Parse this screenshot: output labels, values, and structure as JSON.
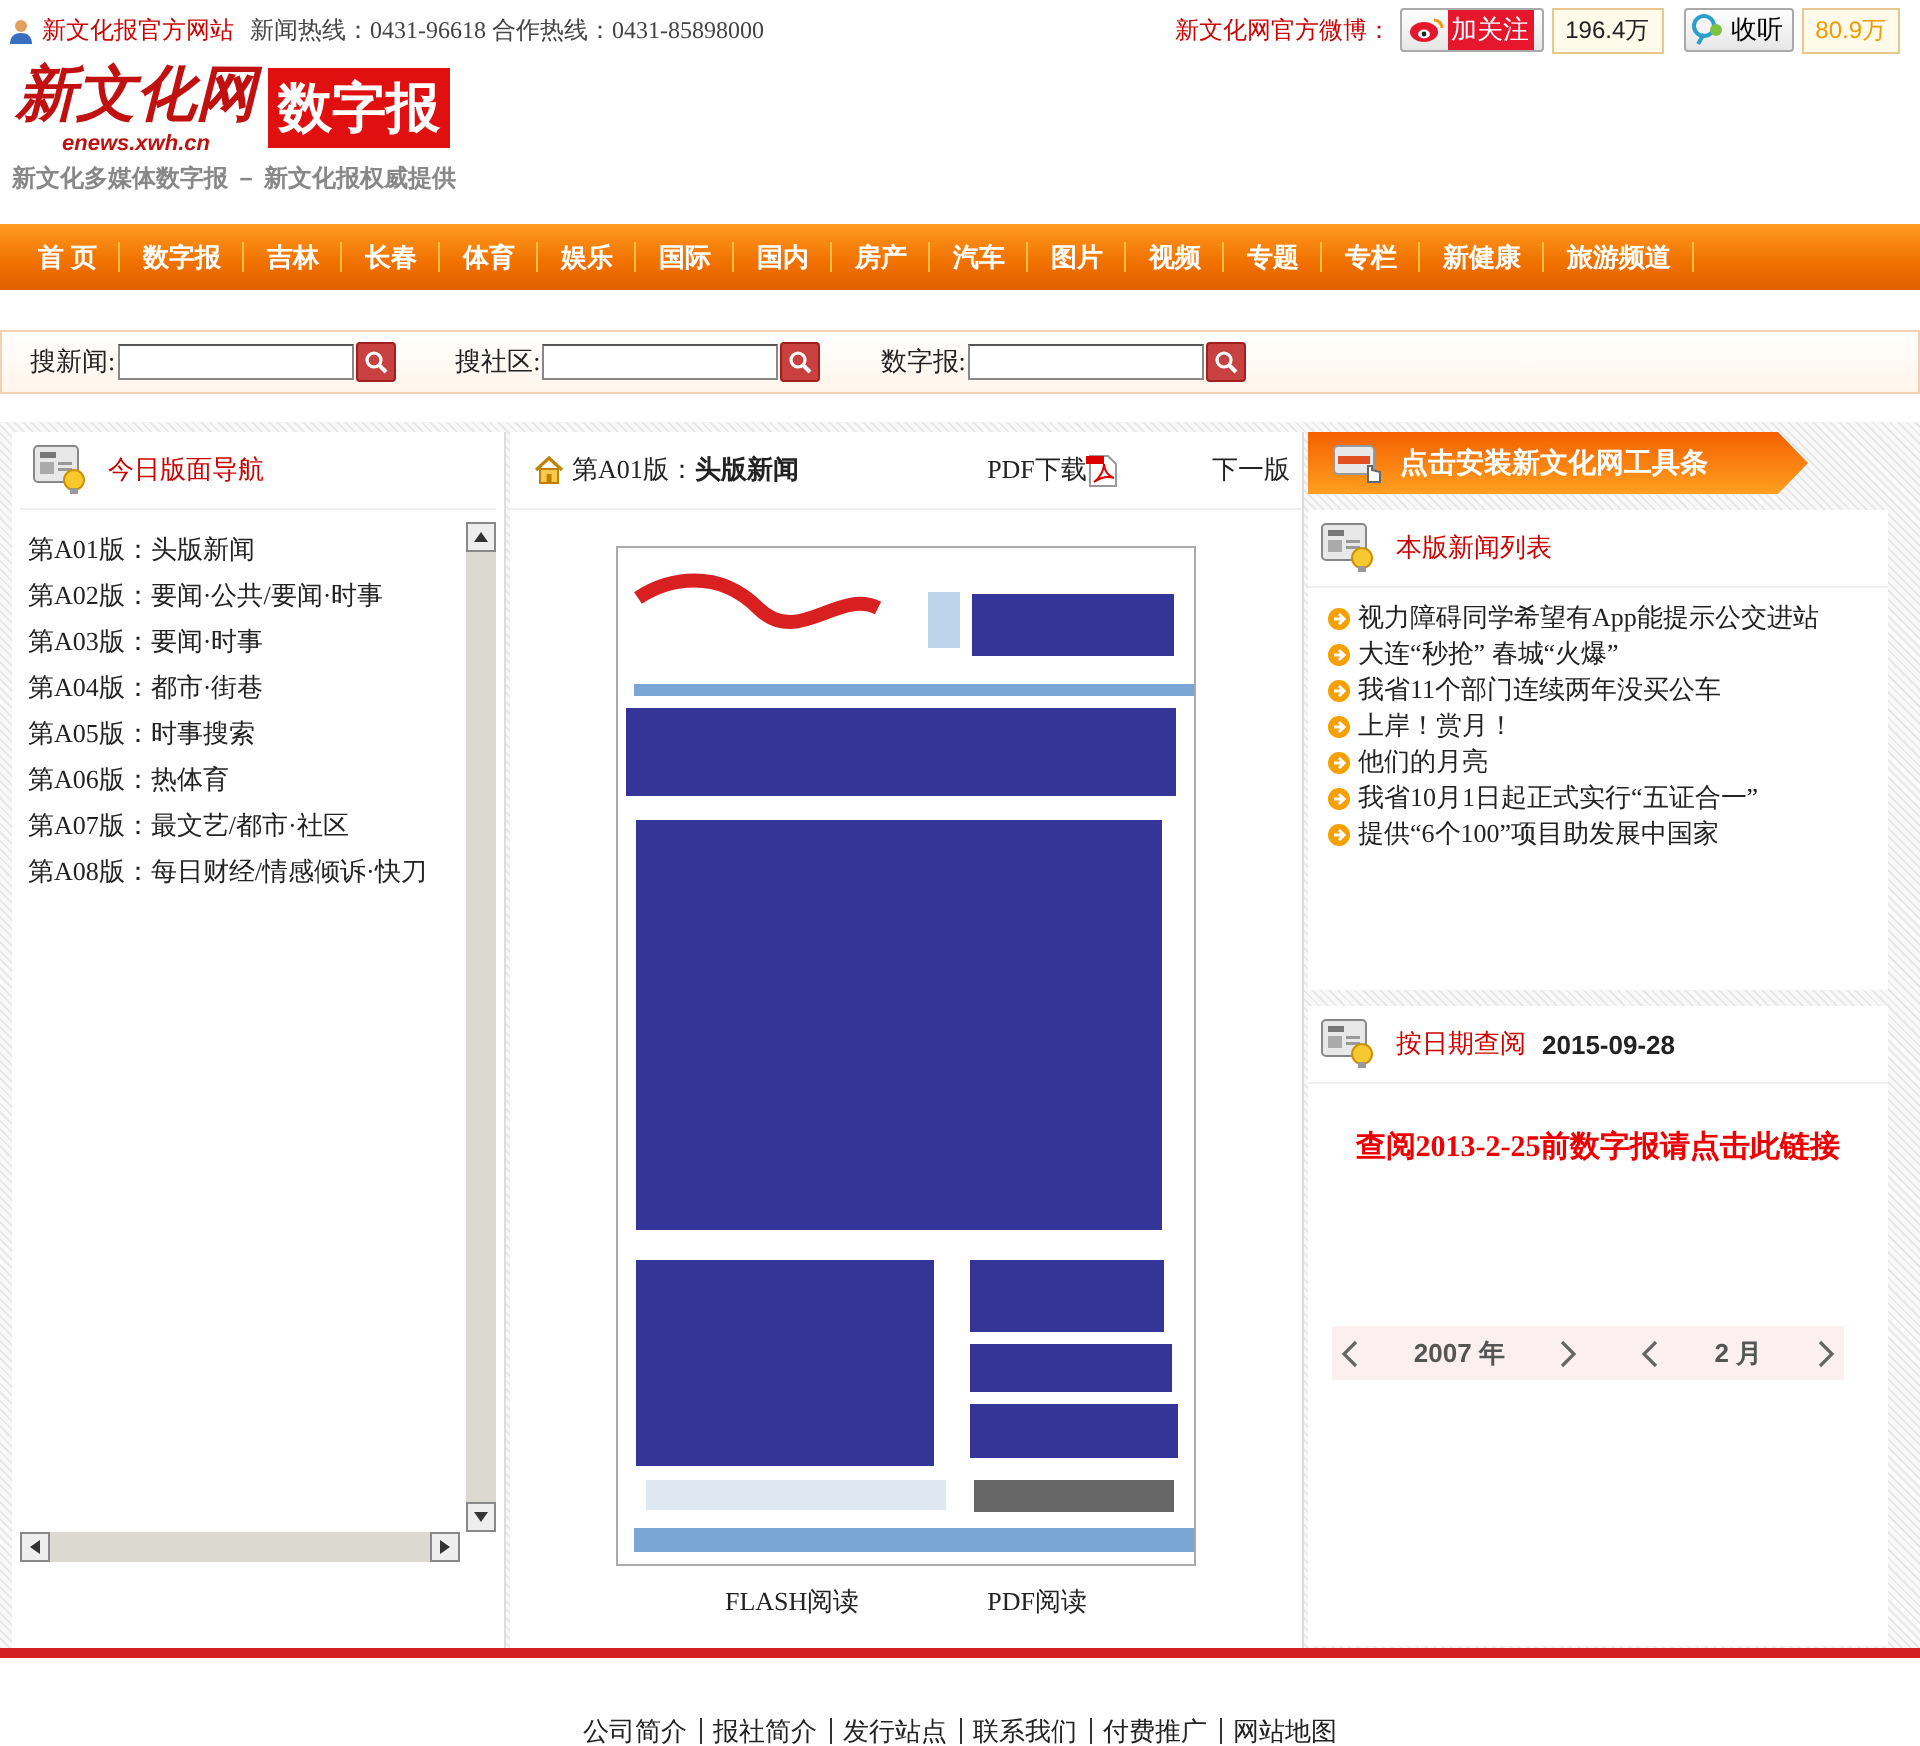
{
  "top_bar": {
    "site_link": "新文化报官方网站",
    "hotlines": "新闻热线：0431-96618 合作热线：0431-85898000",
    "weibo_label": "新文化网官方微博：",
    "follow": [
      {
        "kind": "weibo",
        "label": "加关注",
        "count": "196.4万"
      },
      {
        "kind": "tencent",
        "label": "收听",
        "count": "80.9万"
      }
    ]
  },
  "logo": {
    "title": "新文化网",
    "domain": "enews.xwh.cn",
    "badge": "数字报",
    "tagline": "新文化多媒体数字报 － 新文化报权威提供"
  },
  "nav": [
    "首 页",
    "数字报",
    "吉林",
    "长春",
    "体育",
    "娱乐",
    "国际",
    "国内",
    "房产",
    "汽车",
    "图片",
    "视频",
    "专题",
    "专栏",
    "新健康",
    "旅游频道"
  ],
  "search": [
    {
      "label": "搜新闻:"
    },
    {
      "label": "搜社区:"
    },
    {
      "label": "数字报:"
    }
  ],
  "left": {
    "title": "今日版面导航",
    "pages": [
      "第A01版：头版新闻",
      "第A02版：要闻·公共/要闻·时事",
      "第A03版：要闻·时事",
      "第A04版：都市·街巷",
      "第A05版：时事搜索",
      "第A06版：热体育",
      "第A07版：最文艺/都市·社区",
      "第A08版：每日财经/情感倾诉·快刀"
    ]
  },
  "center": {
    "page_label": "第A01版：",
    "page_name": "头版新闻",
    "pdf_download": "PDF下载",
    "next_page": "下一版",
    "read_links": [
      "FLASH阅读",
      "PDF阅读"
    ]
  },
  "right": {
    "toolbar_banner": "点击安装新文化网工具条",
    "news_title": "本版新闻列表",
    "news": [
      "视力障碍同学希望有App能提示公交进站",
      "大连“秒抢” 春城“火爆”",
      "我省11个部门连续两年没买公车",
      "上岸！赏月！",
      "他们的月亮",
      "我省10月1日起正式实行“五证合一”",
      "提供“6个100”项目助发展中国家"
    ],
    "date_title": "按日期查阅",
    "date": "2015-09-28",
    "archive_link": "查阅2013-2-25前数字报请点击此链接",
    "calendar": {
      "year": "2007",
      "year_unit": "年",
      "month": "2",
      "month_unit": "月"
    }
  },
  "footer": [
    "公司简介",
    "报社简介",
    "发行站点",
    "联系我们",
    "付费推广",
    "网站地图"
  ]
}
